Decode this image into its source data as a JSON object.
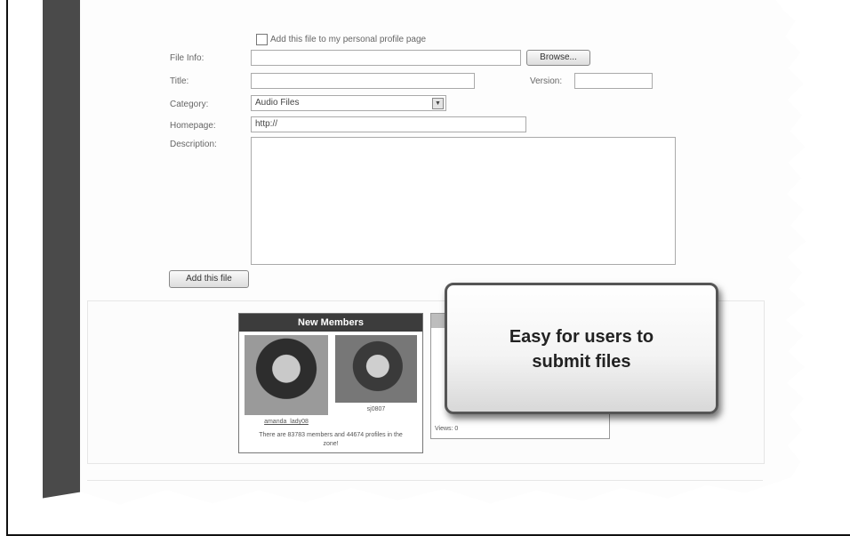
{
  "form": {
    "profile_checkbox_label": "Add this file to my personal profile page",
    "file_label": "File Info:",
    "browse_label": "Browse...",
    "title_label": "Title:",
    "version_label": "Version:",
    "category_label": "Category:",
    "category_value": "Audio Files",
    "homepage_label": "Homepage:",
    "homepage_value": "http://",
    "description_label": "Description:",
    "add_button_label": "Add this file"
  },
  "new_members": {
    "title": "New Members",
    "member1_name": "amanda_lady08",
    "member2_name": "sj0807",
    "summary": "There are 83783 members and 44674 profiles in the zone!"
  },
  "second_box": {
    "footer_label": "Views: 0"
  },
  "callout": {
    "line1": "Easy for users to",
    "line2": "submit files"
  }
}
